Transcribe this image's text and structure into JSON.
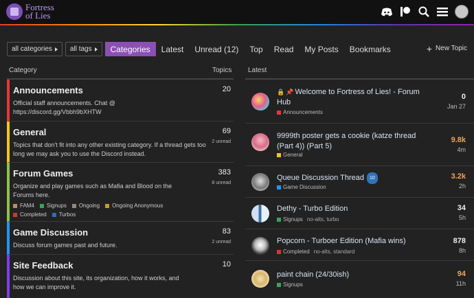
{
  "header": {
    "logo_line1": "Fortress",
    "logo_line2": "of Lies"
  },
  "nav": {
    "all_categories": "all categories",
    "all_tags": "all tags",
    "links": [
      "Categories",
      "Latest",
      "Unread (12)",
      "Top",
      "Read",
      "My Posts",
      "Bookmarks"
    ],
    "new_topic": "New Topic"
  },
  "left": {
    "col_category": "Category",
    "col_topics": "Topics",
    "categories": [
      {
        "title": "Announcements",
        "desc": "Official staff announcements. Chat @ ",
        "link": "https://discord.gg/Vbbh9bXHTW",
        "count": "20",
        "unread": "",
        "color": "#e53935"
      },
      {
        "title": "General",
        "desc": "Topics that don't fit into any other existing category. If a thread gets too long we may ask you to use the Discord instead.",
        "count": "69",
        "unread": "2 unread",
        "color": "#f5c518"
      },
      {
        "title": "Forum Games",
        "desc": "Organize and play games such as Mafia and Blood on the Forums here.",
        "count": "383",
        "unread": "8 unread",
        "color": "#8bc34a",
        "subcategories": [
          {
            "name": "FAM4",
            "color": "#b58c6e"
          },
          {
            "name": "Signups",
            "color": "#3aa35a"
          },
          {
            "name": "Ongoing",
            "color": "#8f8a7a"
          },
          {
            "name": "Ongoing Anonymous",
            "color": "#c59a2e"
          },
          {
            "name": "Completed",
            "color": "#d6382a"
          },
          {
            "name": "Turbos",
            "color": "#2a6fb5"
          }
        ]
      },
      {
        "title": "Game Discussion",
        "desc": "Discuss forum games past and future.",
        "count": "83",
        "unread": "2 unread",
        "color": "#2196f3"
      },
      {
        "title": "Site Feedback",
        "desc": "Discussion about this site, its organization, how it works, and how we can improve it.",
        "count": "10",
        "unread": "",
        "color": "#7e3ff2"
      }
    ]
  },
  "right": {
    "col_latest": "Latest",
    "topics": [
      {
        "title": "Welcome to Fortress of Lies! - Forum Hub",
        "category": "Announcements",
        "cat_color": "#e53935",
        "tags": "",
        "posts": "0",
        "age": "Jan 27",
        "hot": false,
        "badge": ""
      },
      {
        "title": "9999th poster gets a cookie (katze thread (Part 4)) (Part 5)",
        "category": "General",
        "cat_color": "#f5c518",
        "tags": "",
        "posts": "9.8k",
        "age": "4m",
        "hot": true,
        "badge": ""
      },
      {
        "title": "Queue Discussion Thread",
        "category": "Game Discussion",
        "cat_color": "#2196f3",
        "tags": "",
        "posts": "3.2k",
        "age": "2h",
        "hot": true,
        "badge": "10"
      },
      {
        "title": "Dethy - Turbo Edition",
        "category": "Signups",
        "cat_color": "#3aa35a",
        "tags": "no-alts, turbo",
        "posts": "34",
        "age": "5h",
        "hot": false,
        "badge": ""
      },
      {
        "title": "Popcorn - Turboer Edition (Mafia wins)",
        "category": "Completed",
        "cat_color": "#d6382a",
        "tags": "no-alts, standard",
        "posts": "878",
        "age": "8h",
        "hot": false,
        "badge": ""
      },
      {
        "title": "paint chain (24/30ish)",
        "category": "Signups",
        "cat_color": "#3aa35a",
        "tags": "",
        "posts": "94",
        "age": "11h",
        "hot": true,
        "badge": ""
      }
    ]
  }
}
